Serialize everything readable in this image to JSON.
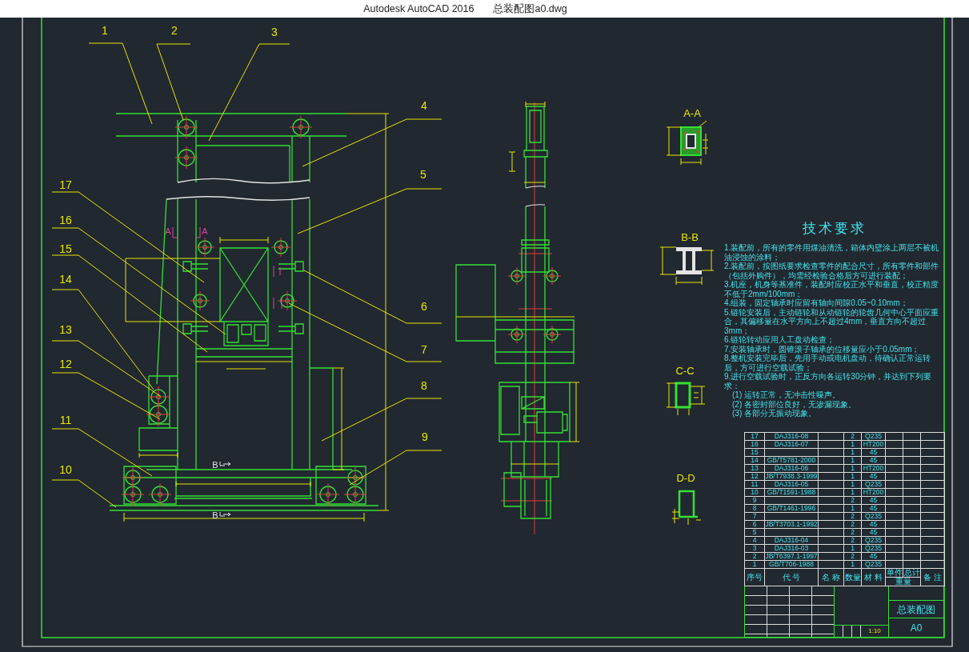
{
  "window": {
    "app_title": "Autodesk AutoCAD 2016",
    "file_name": "总装配图a0.dwg"
  },
  "front_view": {
    "top_part_numbers": [
      "1",
      "2",
      "3"
    ],
    "right_part_numbers": [
      "4",
      "5",
      "6",
      "7",
      "8",
      "9"
    ],
    "left_part_numbers": [
      "17",
      "16",
      "15",
      "14",
      "13",
      "12",
      "11",
      "10"
    ],
    "section_marks": [
      "A",
      "A",
      "B",
      "B"
    ]
  },
  "sections": [
    {
      "kind": "hollow-box",
      "title": "A-A"
    },
    {
      "kind": "i-beam",
      "title": "B-B"
    },
    {
      "kind": "channel",
      "title": "C-C"
    },
    {
      "kind": "angle",
      "title": "D-D"
    }
  ],
  "technical_requirements": {
    "title": "技术要求",
    "items": [
      {
        "text": "1.装配前，所有的零件用煤油清洗，箱体内壁涂上两层不被机油浸蚀的涂料；"
      },
      {
        "text": "2.装配前，按图纸要求检查零件的配合尺寸，所有零件和部件（包括外购件），均需经检验合格后方可进行装配；"
      },
      {
        "text": "3.机座，机身等基准件，装配时应校正水平和垂直，校正精度不低于2mm/100mm；"
      },
      {
        "text": "4.组装，固定轴承时应留有轴向间隙0.05~0.10mm；"
      },
      {
        "text": "5.链轮安装后，主动链轮和从动链轮的轮齿几何中心平面应重合，其偏移量在水平方向上不超过4mm，垂直方向不超过3mm；"
      },
      {
        "text": "6.链轮转动应用人工盘动检查；"
      },
      {
        "text": "7.安装轴承时，圆锥滚子轴承的位移量应小于0.05mm；"
      },
      {
        "text": "8.整机安装完毕后，先用手动或电机盘动，待确认正常运转后，方可进行空载试验；"
      },
      {
        "text": "9.进行空载试验时，正反方向各运转30分钟，并达到下列要求：",
        "children": [
          {
            "text": "(1) 运转正常，无冲击性噪声。"
          },
          {
            "text": "(2) 各密封部位良好，无渗漏现象。"
          },
          {
            "text": "(3) 各部分无振动现象。"
          }
        ]
      }
    ]
  },
  "parts_list": {
    "columns": [
      {
        "kind": "plain",
        "label": "序号"
      },
      {
        "kind": "plain",
        "label": "代 号"
      },
      {
        "kind": "plain",
        "label": "名 称"
      },
      {
        "kind": "plain",
        "label": "数量"
      },
      {
        "kind": "plain",
        "label": "材 料"
      },
      {
        "kind": "split",
        "label": "重量",
        "parts": [
          "单件",
          "总计"
        ]
      },
      {
        "kind": "plain",
        "label": "备 注"
      }
    ],
    "rows": [
      {
        "no": "17",
        "code": "DAJ316-08",
        "quantity": "2",
        "material": "Q235"
      },
      {
        "no": "16",
        "code": "DAJ316-07",
        "quantity": "1",
        "material": "HT200"
      },
      {
        "no": "15",
        "quantity": "1",
        "material": "45"
      },
      {
        "no": "14",
        "code": "GB/T5781-2000",
        "quantity": "1",
        "material": "45"
      },
      {
        "no": "13",
        "code": "DAJ316-06",
        "quantity": "1",
        "material": "HT200"
      },
      {
        "no": "12",
        "code": "JB/T7938.3-1999",
        "quantity": "1",
        "material": "45"
      },
      {
        "no": "11",
        "code": "DAJ316-05",
        "quantity": "1",
        "material": "Q235"
      },
      {
        "no": "10",
        "code": "GB/T1591-1988",
        "quantity": "1",
        "material": "HT200"
      },
      {
        "no": "9",
        "quantity": "2",
        "material": "45"
      },
      {
        "no": "8",
        "code": "GB/T1461-1996",
        "quantity": "1",
        "material": "45"
      },
      {
        "no": "7",
        "quantity": "2",
        "material": "Q235"
      },
      {
        "no": "6",
        "code": "JB/T3703.1-1992",
        "quantity": "2",
        "material": "45"
      },
      {
        "no": "5",
        "quantity": "2",
        "material": "45"
      },
      {
        "no": "4",
        "code": "DAJ316-04",
        "quantity": "2",
        "material": "Q235"
      },
      {
        "no": "3",
        "code": "DAJ316-03",
        "quantity": "1",
        "material": "Q235"
      },
      {
        "no": "2",
        "code": "JB/T6397.1-1997",
        "quantity": "2",
        "material": "45"
      },
      {
        "no": "1",
        "code": "GB/T706-1988",
        "quantity": "1",
        "material": "Q235"
      }
    ]
  },
  "title_block": {
    "drawing_name": "总装配图",
    "sheet_size": "A0",
    "scale": "1:10"
  }
}
